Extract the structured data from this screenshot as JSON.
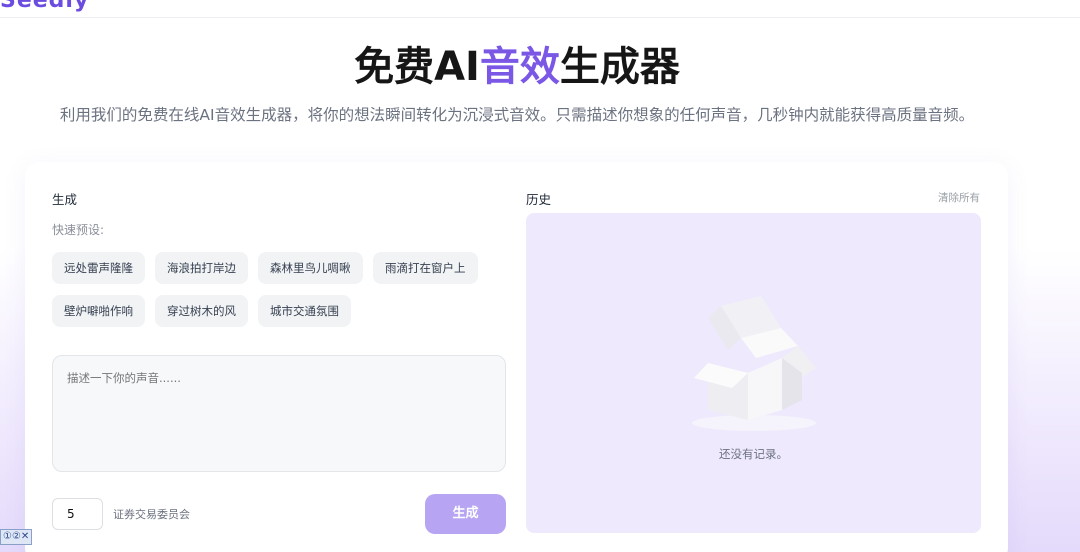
{
  "logo": {
    "text": "Seedly"
  },
  "hero": {
    "title_part1": "免费AI",
    "title_accent": "音效",
    "title_part2": "生成器",
    "subtitle": "利用我们的免费在线AI音效生成器，将你的想法瞬间转化为沉浸式音效。只需描述你想象的任何声音，几秒钟内就能获得高质量音频。"
  },
  "generate": {
    "section_label": "生成",
    "presets_label": "快速预设:",
    "presets": [
      "远处雷声隆隆",
      "海浪拍打岸边",
      "森林里鸟儿啁啾",
      "雨滴打在窗户上",
      "壁炉噼啪作响",
      "穿过树木的风",
      "城市交通氛围"
    ],
    "prompt_placeholder": "描述一下你的声音......",
    "count_value": "5",
    "count_label": "证券交易委员会",
    "button_label": "生成"
  },
  "history": {
    "section_label": "历史",
    "clear_label": "清除所有",
    "empty_text": "还没有记录。"
  },
  "colors": {
    "accent": "#7b57e6",
    "button": "#b7a4f3",
    "history_bg": "#efe9fd"
  },
  "bottom_tag": "①②✕"
}
